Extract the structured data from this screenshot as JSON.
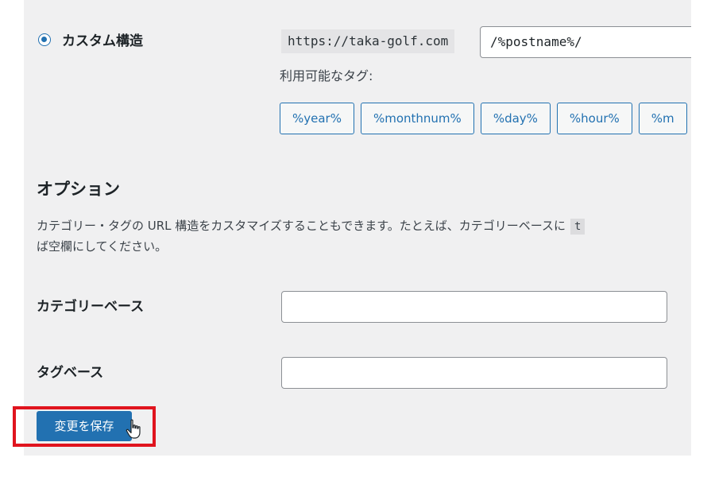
{
  "permalink": {
    "custom_structure_label": "カスタム構造",
    "url_prefix": "https://taka-golf.com",
    "structure_value": "/%postname%/",
    "available_tags_label": "利用可能なタグ:",
    "tags": [
      "%year%",
      "%monthnum%",
      "%day%",
      "%hour%",
      "%m"
    ]
  },
  "options": {
    "title": "オプション",
    "description_line1": "カテゴリー・タグの URL 構造をカスタマイズすることもできます。たとえば、カテゴリーベースに",
    "description_code": "t",
    "description_line2": "ば空欄にしてください。",
    "category_base_label": "カテゴリーベース",
    "category_base_value": "",
    "tag_base_label": "タグベース",
    "tag_base_value": ""
  },
  "save_button_label": "変更を保存",
  "colors": {
    "accent": "#2271b1",
    "highlight_border": "#e0141e",
    "panel_background": "#f0f0f1"
  },
  "icons": {
    "radio": "radio-selected-icon",
    "cursor": "hand-pointer-icon"
  }
}
